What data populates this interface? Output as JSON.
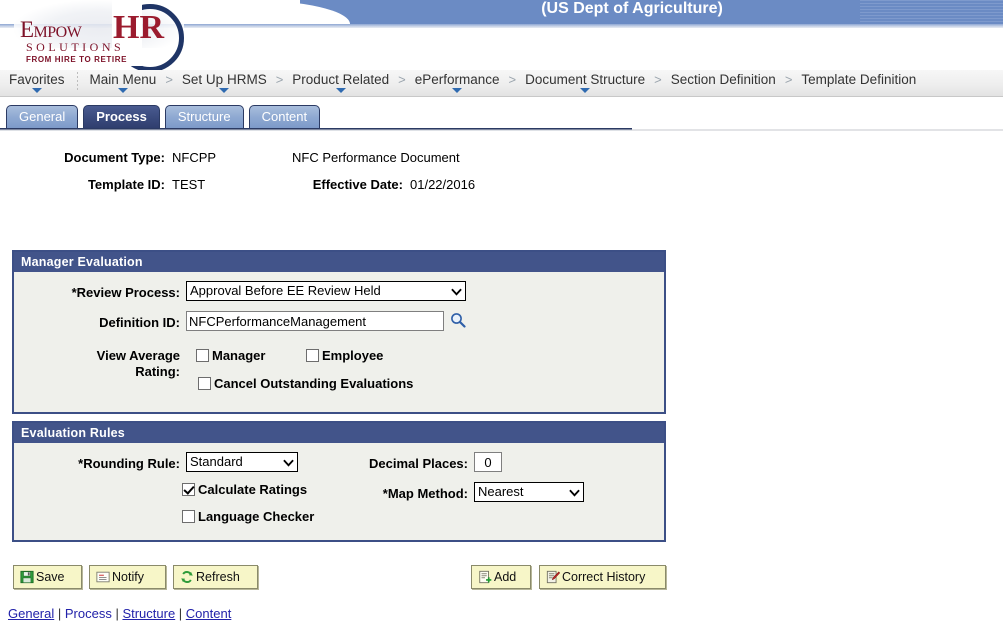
{
  "header": {
    "title": "(US Dept of Agriculture)",
    "logo": {
      "word_mark": "Empow",
      "hr": "HR",
      "solutions": "SOLUTIONS",
      "tagline": "FROM HIRE TO RETIRE"
    }
  },
  "breadcrumb": {
    "separator": ">",
    "items": [
      {
        "label": "Favorites",
        "has_menu": true
      },
      {
        "label": "Main Menu",
        "has_menu": true
      },
      {
        "label": "Set Up HRMS",
        "has_menu": true
      },
      {
        "label": "Product Related",
        "has_menu": true
      },
      {
        "label": "ePerformance",
        "has_menu": true
      },
      {
        "label": "Document Structure",
        "has_menu": true
      },
      {
        "label": "Section Definition",
        "has_menu": false
      },
      {
        "label": "Template Definition",
        "has_menu": false
      }
    ]
  },
  "tabs": [
    {
      "label": "General",
      "active": false
    },
    {
      "label": "Process",
      "active": true
    },
    {
      "label": "Structure",
      "active": false
    },
    {
      "label": "Content",
      "active": false
    }
  ],
  "info": {
    "document_type_label": "Document Type:",
    "document_type_value": "NFCPP",
    "document_type_desc": "NFC Performance Document",
    "template_id_label": "Template ID:",
    "template_id_value": "TEST",
    "effective_date_label": "Effective Date:",
    "effective_date_value": "01/22/2016"
  },
  "manager_evaluation": {
    "title": "Manager Evaluation",
    "review_process_label": "*Review Process:",
    "review_process_value": "Approval Before EE Review Held",
    "definition_id_label": "Definition ID:",
    "definition_id_value": "NFCPerformanceManagement",
    "view_average_rating_label_line1": "View Average",
    "view_average_rating_label_line2": "Rating:",
    "checkbox_manager": "Manager",
    "checkbox_manager_checked": false,
    "checkbox_employee": "Employee",
    "checkbox_employee_checked": false,
    "checkbox_cancel_outstanding": "Cancel Outstanding Evaluations",
    "checkbox_cancel_outstanding_checked": false
  },
  "evaluation_rules": {
    "title": "Evaluation Rules",
    "rounding_rule_label": "*Rounding Rule:",
    "rounding_rule_value": "Standard",
    "decimal_places_label": "Decimal Places:",
    "decimal_places_value": "0",
    "calculate_ratings_label": "Calculate Ratings",
    "calculate_ratings_checked": true,
    "language_checker_label": "Language Checker",
    "language_checker_checked": false,
    "map_method_label": "*Map Method:",
    "map_method_value": "Nearest"
  },
  "buttons": {
    "save": "Save",
    "notify": "Notify",
    "refresh": "Refresh",
    "add": "Add",
    "correct_history": "Correct History"
  },
  "footer_links": {
    "general": "General",
    "process": "Process",
    "structure": "Structure",
    "content": "Content",
    "sep1": " | ",
    "sep2": " | ",
    "sep3": " | "
  },
  "colors": {
    "banner_blue": "#6b8bc4",
    "group_header": "#42548a",
    "group_body": "#eff0eb",
    "tab_active": "#2f3e6e",
    "tab_inactive": "#8fa9d2",
    "button_yellow": "#f7f6c8",
    "logo_red": "#9b1b2e",
    "link_blue": "#2222aa"
  }
}
